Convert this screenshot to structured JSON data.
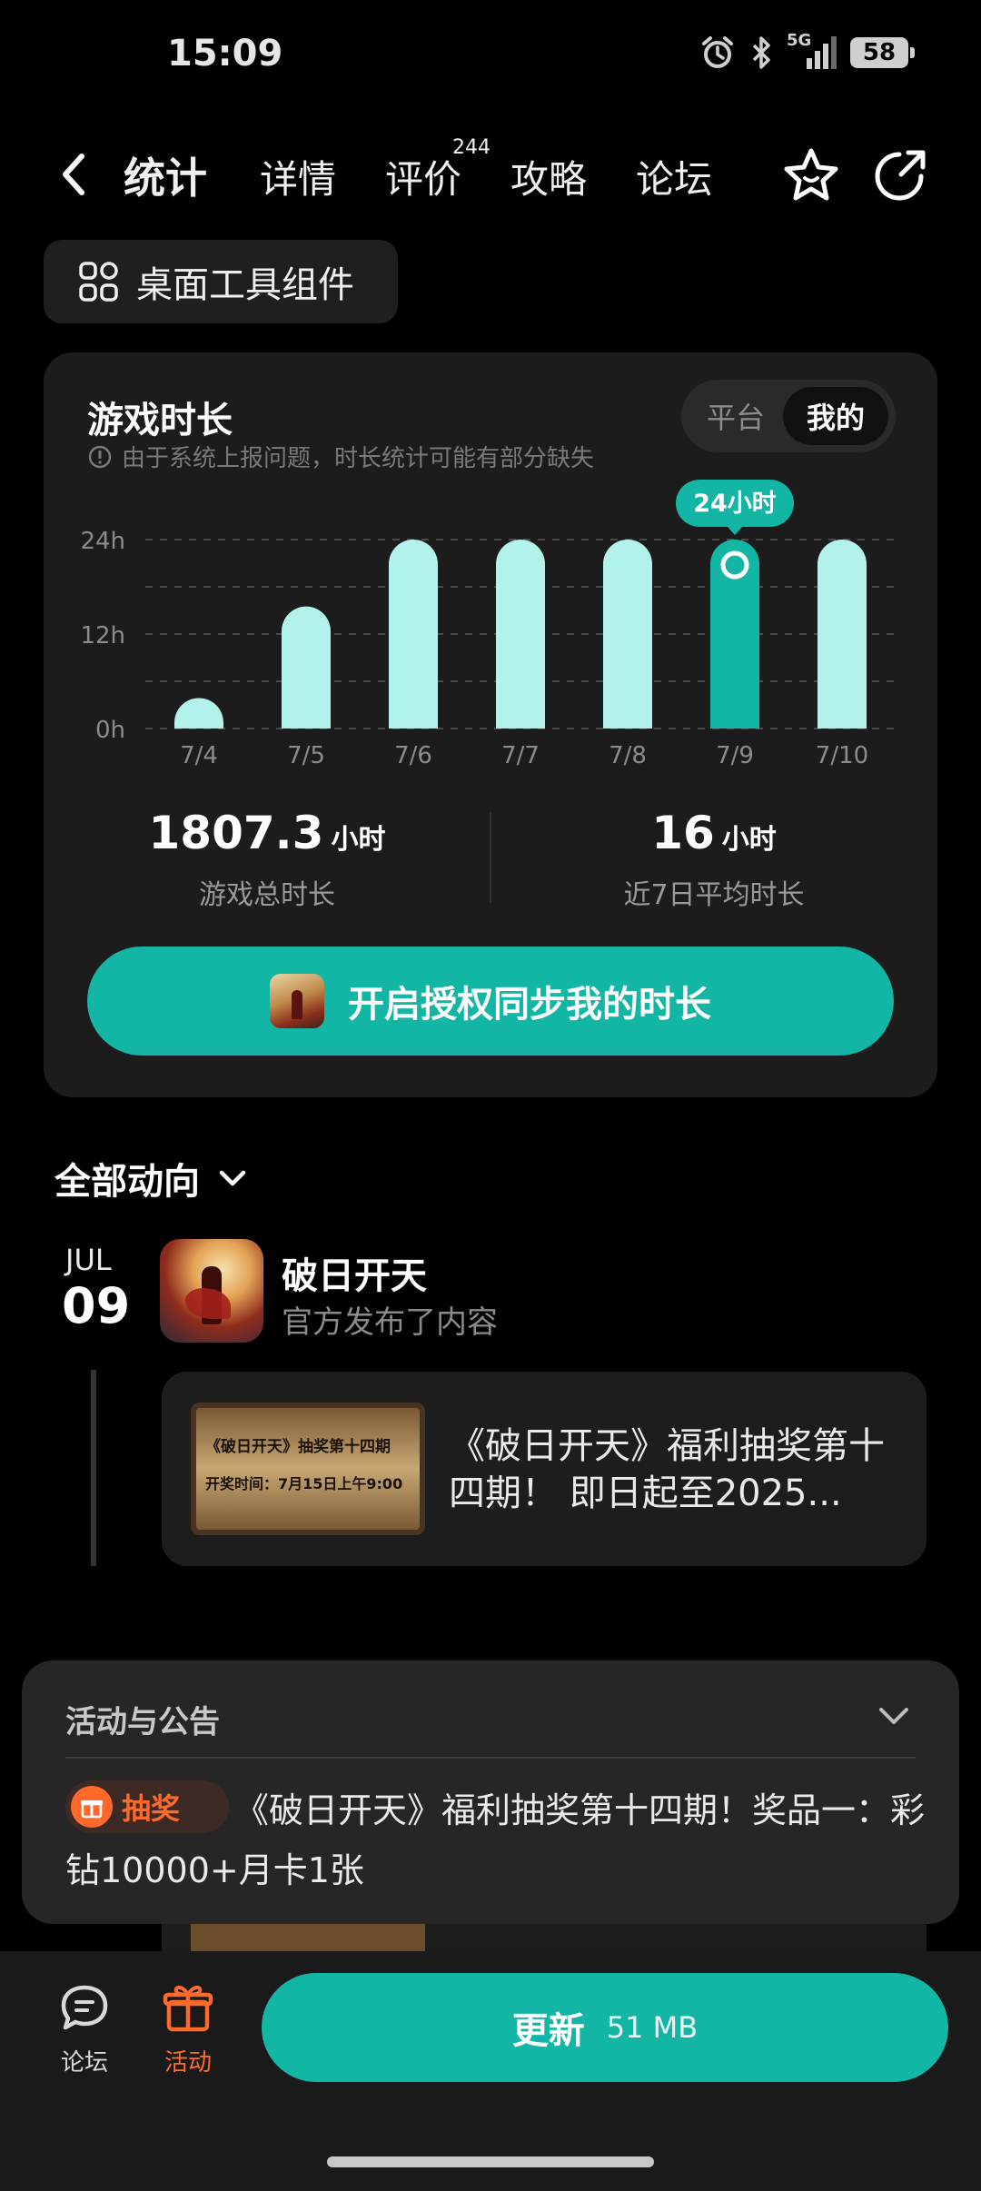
{
  "status_bar": {
    "time": "15:09",
    "network": "5G",
    "battery": "58"
  },
  "nav": {
    "tabs": [
      {
        "label": "统计"
      },
      {
        "label": "详情"
      },
      {
        "label": "评价"
      },
      {
        "label": "攻略"
      },
      {
        "label": "论坛"
      }
    ],
    "review_count": "244"
  },
  "widget_chip": {
    "label": "桌面工具组件"
  },
  "stats": {
    "title": "游戏时长",
    "note": "由于系统上报问题，时长统计可能有部分缺失",
    "segment": {
      "platform": "平台",
      "mine": "我的"
    },
    "tooltip": "24小时",
    "total": {
      "value": "1807.3",
      "unit": "小时",
      "caption": "游戏总时长"
    },
    "average": {
      "value": "16",
      "unit": "小时",
      "caption": "近7日平均时长"
    },
    "sync_button": "开启授权同步我的时长"
  },
  "chart_data": {
    "type": "bar",
    "categories": [
      "7/4",
      "7/5",
      "7/6",
      "7/7",
      "7/8",
      "7/9",
      "7/10"
    ],
    "values": [
      1.5,
      15.5,
      24,
      24,
      24,
      24,
      24
    ],
    "ylim": [
      0,
      24
    ],
    "yticks": [
      "0h",
      "12h",
      "24h"
    ],
    "highlight_index": 5,
    "colors": {
      "bar": "#b3f2ea",
      "highlight": "#13b5a4"
    }
  },
  "feed": {
    "title": "全部动向",
    "month": "JUL",
    "day": "09",
    "app_name": "破日开天",
    "subtitle": "官方发布了内容",
    "post_text": "《破日开天》福利抽奖第十四期！ 即日起至2025...",
    "thumb_line1": "《破日开天》抽奖第十四期",
    "thumb_line2": "开奖时间：7月15日上午9:00"
  },
  "announcement": {
    "title": "活动与公告",
    "badge": "抽奖",
    "text": "《破日开天》福利抽奖第十四期！奖品一：彩钻10000+月卡1张"
  },
  "bottom_bar": {
    "forum_label": "论坛",
    "activity_label": "活动",
    "update_label": "更新",
    "update_size": "51 MB"
  },
  "colors": {
    "accent": "#13b5a4",
    "activity": "#ff6a2b"
  }
}
